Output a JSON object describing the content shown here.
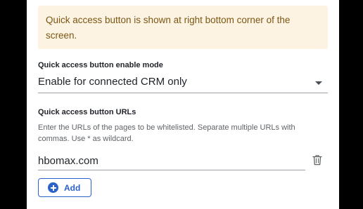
{
  "info": {
    "text": "Quick access button is shown at right bottom corner of the screen."
  },
  "enable_mode": {
    "label": "Quick access button enable mode",
    "value": "Enable for connected CRM only",
    "arrow_icon": "caret-down-icon"
  },
  "urls": {
    "label": "Quick access button URLs",
    "help": "Enter the URLs of the pages to be whitelisted. Separate multiple URLs with commas. Use * as wildcard.",
    "items": [
      {
        "value": "hbomax.com",
        "delete_icon": "trash-icon"
      }
    ],
    "add_label": "Add",
    "add_icon": "plus-circle-icon"
  },
  "colors": {
    "info_bg": "#fdf3e3",
    "info_text": "#7a5612",
    "accent": "#2b63c9"
  }
}
